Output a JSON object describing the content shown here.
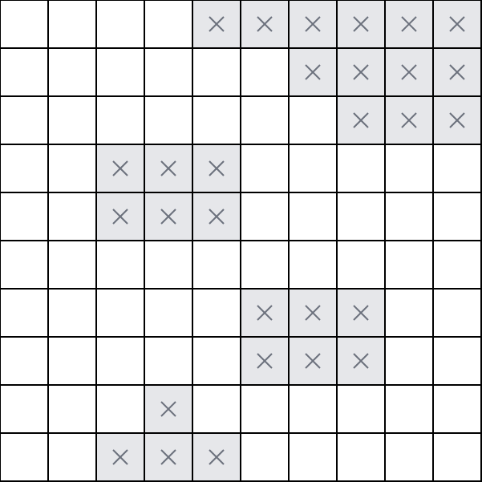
{
  "board": {
    "rows": 10,
    "cols": 10,
    "cell_colors": {
      "empty": "#ffffff",
      "marked": "#e6e7ea",
      "mark_stroke": "#6c717d",
      "grid_line": "#000000"
    },
    "mark_icon": "x-mark-icon",
    "cells": [
      [
        0,
        0,
        0,
        0,
        1,
        1,
        1,
        1,
        1,
        1
      ],
      [
        0,
        0,
        0,
        0,
        0,
        0,
        1,
        1,
        1,
        1
      ],
      [
        0,
        0,
        0,
        0,
        0,
        0,
        0,
        1,
        1,
        1
      ],
      [
        0,
        0,
        1,
        1,
        1,
        0,
        0,
        0,
        0,
        0
      ],
      [
        0,
        0,
        1,
        1,
        1,
        0,
        0,
        0,
        0,
        0
      ],
      [
        0,
        0,
        0,
        0,
        0,
        0,
        0,
        0,
        0,
        0
      ],
      [
        0,
        0,
        0,
        0,
        0,
        1,
        1,
        1,
        0,
        0
      ],
      [
        0,
        0,
        0,
        0,
        0,
        1,
        1,
        1,
        0,
        0
      ],
      [
        0,
        0,
        0,
        1,
        0,
        0,
        0,
        0,
        0,
        0
      ],
      [
        0,
        0,
        1,
        1,
        1,
        0,
        0,
        0,
        0,
        0
      ]
    ]
  }
}
